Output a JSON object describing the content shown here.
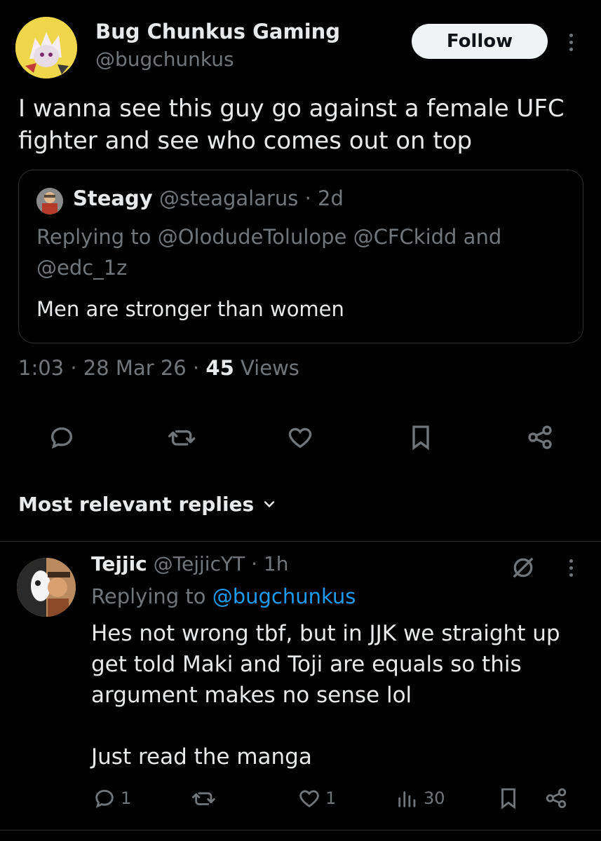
{
  "tweet": {
    "author_name": "Bug Chunkus Gaming",
    "author_handle": "@bugchunkus",
    "follow_label": "Follow",
    "text": "I wanna see this guy go against a female UFC fighter and see who comes out on top",
    "quote": {
      "name": "Steagy",
      "handle": "@steagalarus",
      "time": "· 2d",
      "replying": "Replying to @OlodudeTolulope @CFCkidd and @edc_1z",
      "text": "Men are stronger than women"
    },
    "time": "1:03",
    "date": "· 28 Mar 26 ·",
    "views_count": "45",
    "views_label": "Views"
  },
  "replies_header": {
    "label": "Most relevant replies"
  },
  "reply": {
    "name": "Tejjic",
    "handle": "@TejjicYT",
    "time": "· 1h",
    "replying_prefix": "Replying to",
    "replying_to": "@bugchunkus",
    "text_line1": "Hes not wrong tbf, but in JJK we straight up",
    "text_line2": "get told Maki and Toji are equals so this",
    "text_line3": "argument  makes no sense lol",
    "text_line4": "Just read the manga",
    "reply_count": "1",
    "like_count": "1",
    "views_count": "30"
  },
  "colors": {
    "background": "#000000",
    "text": "#e7e9ea",
    "muted": "#71767b",
    "link": "#1d9bf0",
    "border": "#2f3336"
  }
}
